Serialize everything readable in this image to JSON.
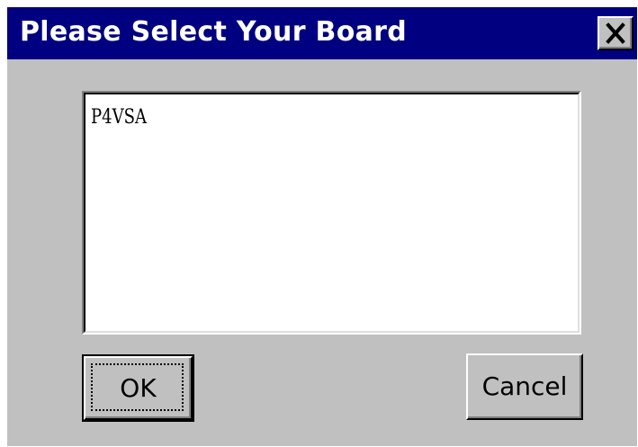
{
  "window": {
    "title": "Please Select Your Board",
    "close_label": "X"
  },
  "listbox": {
    "items": [
      {
        "label": "P4VSA"
      }
    ]
  },
  "buttons": {
    "ok_label": "OK",
    "cancel_label": "Cancel"
  },
  "colors": {
    "titlebar": "#000080",
    "title_text": "#ffffff",
    "window_bg": "#c0c0c0",
    "listbox_bg": "#ffffff"
  },
  "icons": {
    "close": "close-icon"
  }
}
